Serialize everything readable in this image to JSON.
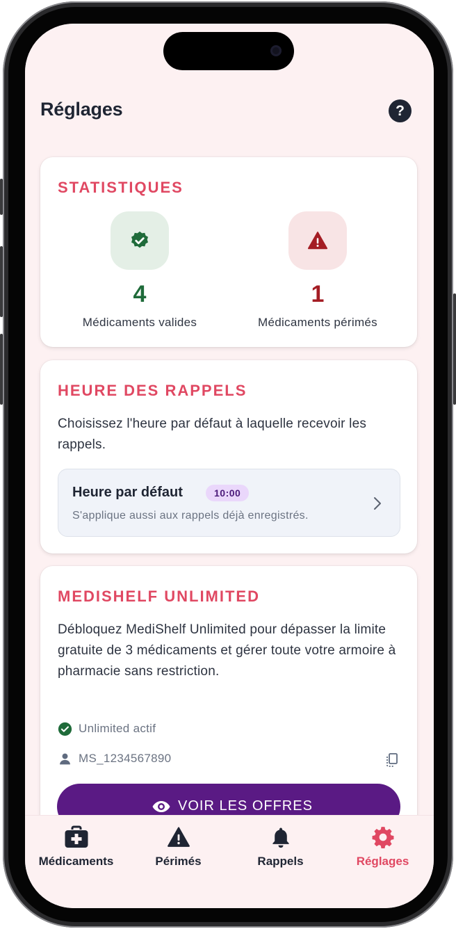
{
  "page": {
    "title": "Réglages",
    "help_label": "?"
  },
  "statistics": {
    "title": "STATISTIQUES",
    "valid": {
      "value": "4",
      "label": "Médicaments valides",
      "color": "#1f6b3a"
    },
    "expired": {
      "value": "1",
      "label": "Médicaments périmés",
      "color": "#a41d24"
    }
  },
  "reminders": {
    "title": "HEURE DES RAPPELS",
    "description": "Choisissez l'heure par défaut à laquelle recevoir les rappels.",
    "default_title": "Heure par défaut",
    "default_time": "10:00",
    "default_subtitle": "S'applique aussi aux rappels déjà enregistrés."
  },
  "unlimited": {
    "title": "MEDISHELF UNLIMITED",
    "description": "Débloquez MediShelf Unlimited pour dépasser la limite gratuite de 3 médicaments et gérer toute votre armoire à pharmacie sans restriction.",
    "status": "Unlimited actif",
    "user_id": "MS_1234567890",
    "offers_button": "VOIR LES OFFRES"
  },
  "tabs": [
    {
      "label": "Médicaments",
      "icon": "medical-kit-icon",
      "active": false
    },
    {
      "label": "Périmés",
      "icon": "warning-icon",
      "active": false
    },
    {
      "label": "Rappels",
      "icon": "bell-icon",
      "active": false
    },
    {
      "label": "Réglages",
      "icon": "gear-icon",
      "active": true
    }
  ],
  "colors": {
    "accent": "#e04862",
    "background": "#fdf1f2",
    "purple": "#5a1a84",
    "valid_green": "#1f6b3a",
    "expired_red": "#a41d24"
  }
}
